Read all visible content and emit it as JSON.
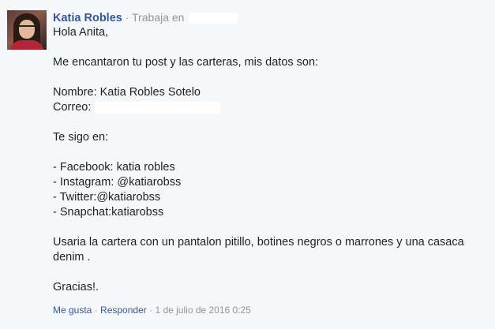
{
  "comment": {
    "author": "Katia Robles",
    "separator": "·",
    "works_at": "Trabaja en",
    "lines": [
      "Hola Anita,",
      "Me encantaron tu post y las carteras, mis datos son:",
      "Nombre: Katia Robles Sotelo",
      "Correo:",
      "Te sigo en:",
      "- Facebook: katia robles",
      "- Instagram: @katiarobss",
      "- Twitter:@katiarobss",
      "- Snapchat:katiarobss",
      "Usaria la cartera con un pantalon pitillo, botines negros o marrones y una casaca",
      "denim .",
      "Gracias!."
    ]
  },
  "footer": {
    "like": "Me gusta",
    "reply": "Responder",
    "sep": "·",
    "timestamp": "1 de julio de 2016 0:25"
  }
}
